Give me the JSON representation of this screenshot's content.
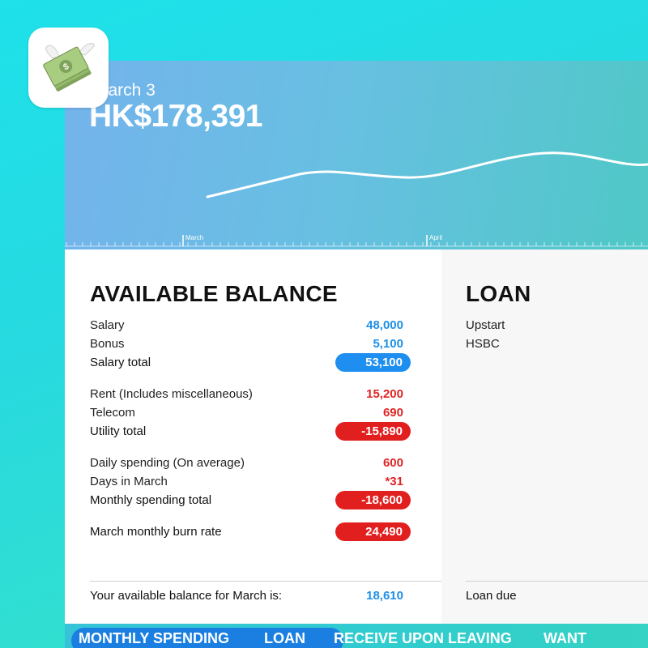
{
  "header": {
    "date": "March 3",
    "amount": "HK$178,391",
    "axis_labels": [
      "March",
      "April"
    ]
  },
  "available_balance": {
    "title": "AVAILABLE BALANCE",
    "income": [
      {
        "label": "Salary",
        "value": "48,000"
      },
      {
        "label": "Bonus",
        "value": "5,100"
      }
    ],
    "income_total": {
      "label": "Salary total",
      "value": "53,100"
    },
    "utilities": [
      {
        "label": "Rent (Includes miscellaneous)",
        "value": "15,200"
      },
      {
        "label": "Telecom",
        "value": "690"
      }
    ],
    "utility_total": {
      "label": "Utility total",
      "value": "-15,890"
    },
    "spending": [
      {
        "label": "Daily spending (On average)",
        "value": "600"
      },
      {
        "label": "Days in March",
        "value": "*31"
      }
    ],
    "spending_total": {
      "label": "Monthly spending total",
      "value": "-18,600"
    },
    "burn_rate": {
      "label": "March monthly burn rate",
      "value": "24,490"
    },
    "footer": {
      "label": "Your available balance for March is:",
      "value": "18,610"
    }
  },
  "loan": {
    "title": "LOAN",
    "items": [
      "Upstart",
      "HSBC"
    ],
    "footer_label": "Loan due"
  },
  "tabs": [
    "MONTHLY SPENDING",
    "LOAN",
    "RECEIVE UPON LEAVING",
    "WANT"
  ],
  "colors": {
    "positive": "#1e8fe6",
    "negative": "#e02424",
    "active_tab": "#1a7fe0"
  },
  "app_icon": "flying-money-icon"
}
